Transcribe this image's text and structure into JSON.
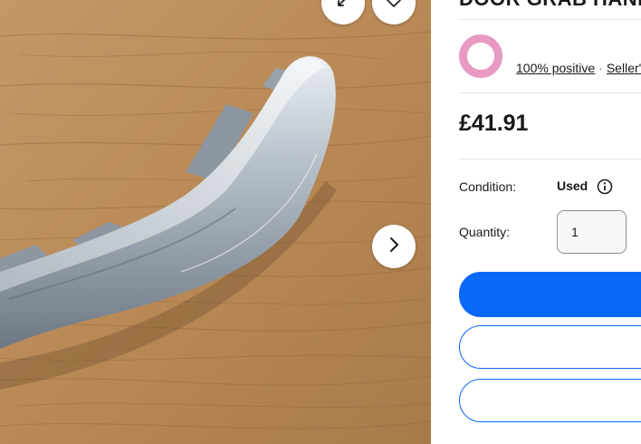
{
  "listing": {
    "title": "DOOR GRAB HANDLE",
    "price": "£41.91"
  },
  "seller": {
    "name": "",
    "feedback_positive": "100% positive",
    "separator": "·",
    "sellers_other_items": "Seller's other items"
  },
  "details": {
    "condition_label": "Condition:",
    "condition_value": "Used",
    "quantity_label": "Quantity:",
    "quantity_value": "1"
  },
  "actions": {
    "buy_now": "",
    "add_to_basket": "",
    "watchlist": ""
  },
  "gallery": {
    "icons": [
      "expand-icon",
      "heart-icon",
      "chevron-right-icon"
    ]
  },
  "colors": {
    "accent": "#0968f6",
    "avatar_ring": "#e89ac2",
    "text": "#191919",
    "divider": "#e5e5e5"
  }
}
